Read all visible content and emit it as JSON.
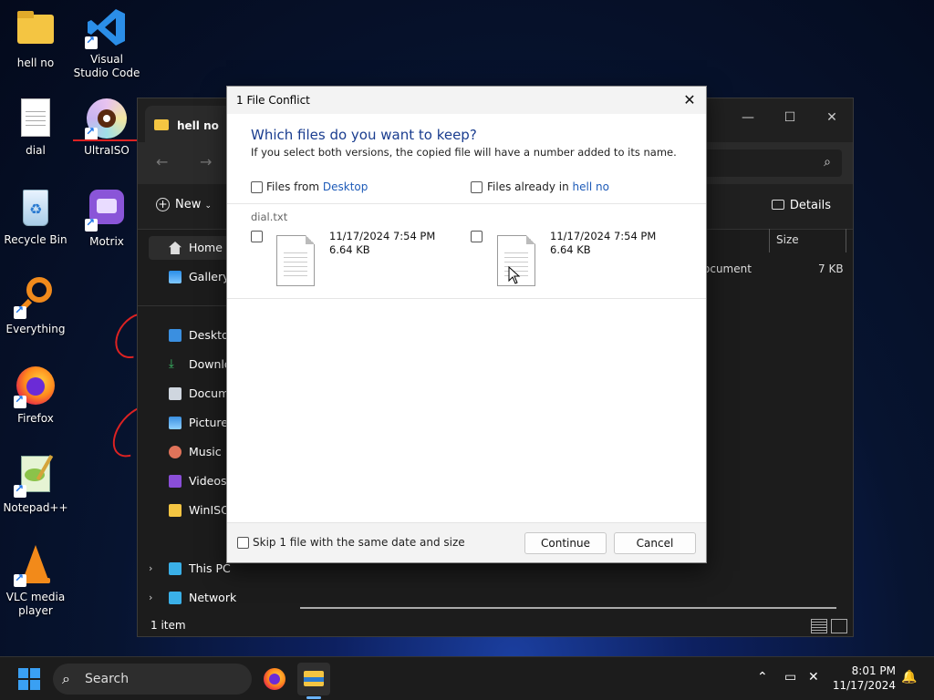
{
  "desktop": {
    "icons": [
      {
        "label": "hell no"
      },
      {
        "label": "Visual Studio Code"
      },
      {
        "label": "dial"
      },
      {
        "label": "UltraISO"
      },
      {
        "label": "Recycle Bin"
      },
      {
        "label": "Motrix"
      },
      {
        "label": "Everything"
      },
      {
        "label": "Firefox"
      },
      {
        "label": "Notepad++"
      },
      {
        "label": "VLC media player"
      }
    ]
  },
  "explorer": {
    "tab_title": "hell no",
    "new_label": "New",
    "details_label": "Details",
    "column_size": "Size",
    "row_type": "ocument",
    "row_size": "7 KB",
    "status": "1 item",
    "sidebar": [
      {
        "label": "Home"
      },
      {
        "label": "Gallery"
      },
      {
        "label": "Desktop"
      },
      {
        "label": "Downlo"
      },
      {
        "label": "Docume"
      },
      {
        "label": "Pictures"
      },
      {
        "label": "Music"
      },
      {
        "label": "Videos"
      },
      {
        "label": "WinISO"
      },
      {
        "label": "This PC"
      },
      {
        "label": "Network"
      }
    ]
  },
  "dialog": {
    "title": "1 File Conflict",
    "heading": "Which files do you want to keep?",
    "subtext": "If you select both versions, the copied file will have a number added to its name.",
    "left_header_prefix": "Files from ",
    "left_header_link": "Desktop",
    "right_header_prefix": "Files already in ",
    "right_header_link": "hell no",
    "file_name": "dial.txt",
    "left_file": {
      "date": "11/17/2024 7:54 PM",
      "size": "6.64 KB"
    },
    "right_file": {
      "date": "11/17/2024 7:54 PM",
      "size": "6.64 KB"
    },
    "skip_label": "Skip 1 file with the same date and size",
    "continue_label": "Continue",
    "cancel_label": "Cancel"
  },
  "taskbar": {
    "search_label": "Search",
    "time": "8:01 PM",
    "date": "11/17/2024"
  }
}
